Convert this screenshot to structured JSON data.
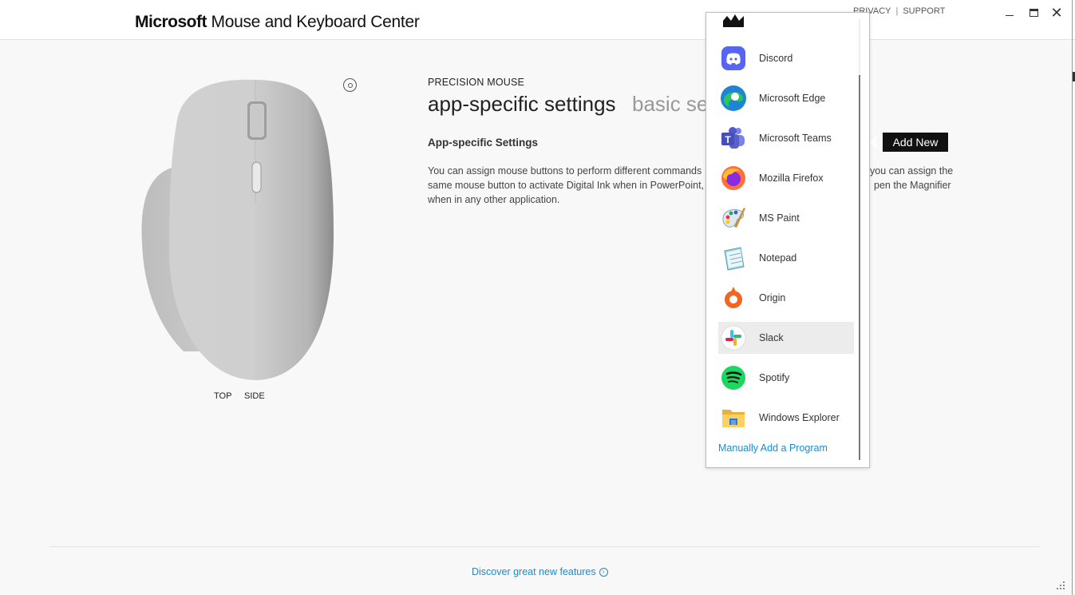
{
  "window": {
    "brand_bold": "Microsoft",
    "brand_rest": " Mouse and Keyboard Center",
    "privacy": "PRIVACY",
    "separator": "|",
    "support": "SUPPORT",
    "minimize_icon": "minimize-icon",
    "maximize_icon": "maximize-icon",
    "close_icon": "close-icon"
  },
  "device": {
    "name": "PRECISION MOUSE",
    "views": [
      "TOP",
      "SIDE"
    ]
  },
  "tabs": {
    "active": "app-specific settings",
    "inactive": "basic se"
  },
  "content": {
    "section_title": "App-specific Settings",
    "desc_line1": "You can assign mouse buttons to perform different commands",
    "desc_line1_tail": "you can assign the",
    "desc_line2": "same mouse button to activate Digital Ink when in PowerPoint,",
    "desc_line2_tail": "pen the Magnifier",
    "desc_line3": "when in any other application."
  },
  "add_new": {
    "label": "Add New"
  },
  "app_list": {
    "items": [
      {
        "label": "",
        "icon": "app-icon"
      },
      {
        "label": "Discord",
        "icon": "discord-icon"
      },
      {
        "label": "Microsoft Edge",
        "icon": "edge-icon"
      },
      {
        "label": "Microsoft Teams",
        "icon": "teams-icon"
      },
      {
        "label": "Mozilla Firefox",
        "icon": "firefox-icon"
      },
      {
        "label": "MS Paint",
        "icon": "paint-icon"
      },
      {
        "label": "Notepad",
        "icon": "notepad-icon"
      },
      {
        "label": "Origin",
        "icon": "origin-icon"
      },
      {
        "label": "Slack",
        "icon": "slack-icon",
        "selected": true
      },
      {
        "label": "Spotify",
        "icon": "spotify-icon"
      },
      {
        "label": "Windows Explorer",
        "icon": "folder-icon"
      }
    ],
    "manual_add": "Manually Add a Program"
  },
  "footer": {
    "discover": "Discover great new features"
  },
  "colors": {
    "accent_link": "#1a8ccf",
    "selected_row": "#ececec",
    "add_new_bg": "#111111"
  }
}
